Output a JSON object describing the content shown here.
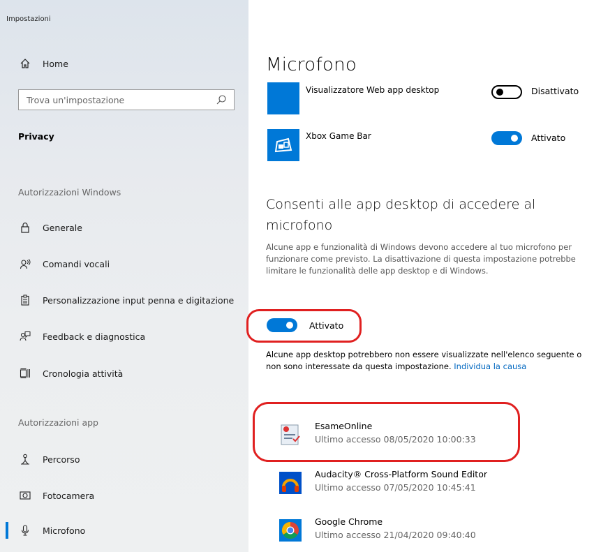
{
  "window": {
    "title": "Impostazioni"
  },
  "sidebar": {
    "home_label": "Home",
    "search_placeholder": "Trova un'impostazione",
    "current_section": "Privacy",
    "group_windows": "Autorizzazioni Windows",
    "windows_items": [
      {
        "label": "Generale",
        "icon": "lock-icon"
      },
      {
        "label": "Comandi vocali",
        "icon": "speech-icon"
      },
      {
        "label": "Personalizzazione input penna e digitazione",
        "icon": "clipboard-icon"
      },
      {
        "label": "Feedback e diagnostica",
        "icon": "feedback-icon"
      },
      {
        "label": "Cronologia attività",
        "icon": "timeline-icon"
      }
    ],
    "group_apps": "Autorizzazioni app",
    "app_items": [
      {
        "label": "Percorso",
        "icon": "location-icon"
      },
      {
        "label": "Fotocamera",
        "icon": "camera-icon"
      },
      {
        "label": "Microfono",
        "icon": "microphone-icon",
        "selected": true
      }
    ]
  },
  "main": {
    "title": "Microfono",
    "store_apps": [
      {
        "name": "Visualizzatore Web app desktop",
        "state": "off",
        "state_label": "Disattivato"
      },
      {
        "name": "Xbox Game Bar",
        "state": "on",
        "state_label": "Attivato"
      }
    ],
    "desktop_section": {
      "title": "Consenti alle app desktop di accedere al microfono",
      "description": "Alcune app e funzionalità di Windows devono accedere al tuo microfono per funzionare come previsto. La disattivazione di questa impostazione potrebbe limitare le funzionalità delle app desktop e di Windows.",
      "toggle_state": "on",
      "toggle_label": "Attivato",
      "note": "Alcune app desktop potrebbero non essere visualizzate nell'elenco seguente o non sono interessate da questa impostazione. ",
      "note_link": "Individua la causa"
    },
    "desktop_apps": [
      {
        "name": "EsameOnline",
        "last_access": "Ultimo accesso 08/05/2020 10:00:33"
      },
      {
        "name": "Audacity® Cross-Platform Sound Editor",
        "last_access": "Ultimo accesso 07/05/2020 10:45:41"
      },
      {
        "name": "Google Chrome",
        "last_access": "Ultimo accesso 21/04/2020 09:40:40"
      }
    ]
  },
  "colors": {
    "accent": "#0078d7",
    "highlight": "#e02020",
    "link": "#0067c0"
  }
}
